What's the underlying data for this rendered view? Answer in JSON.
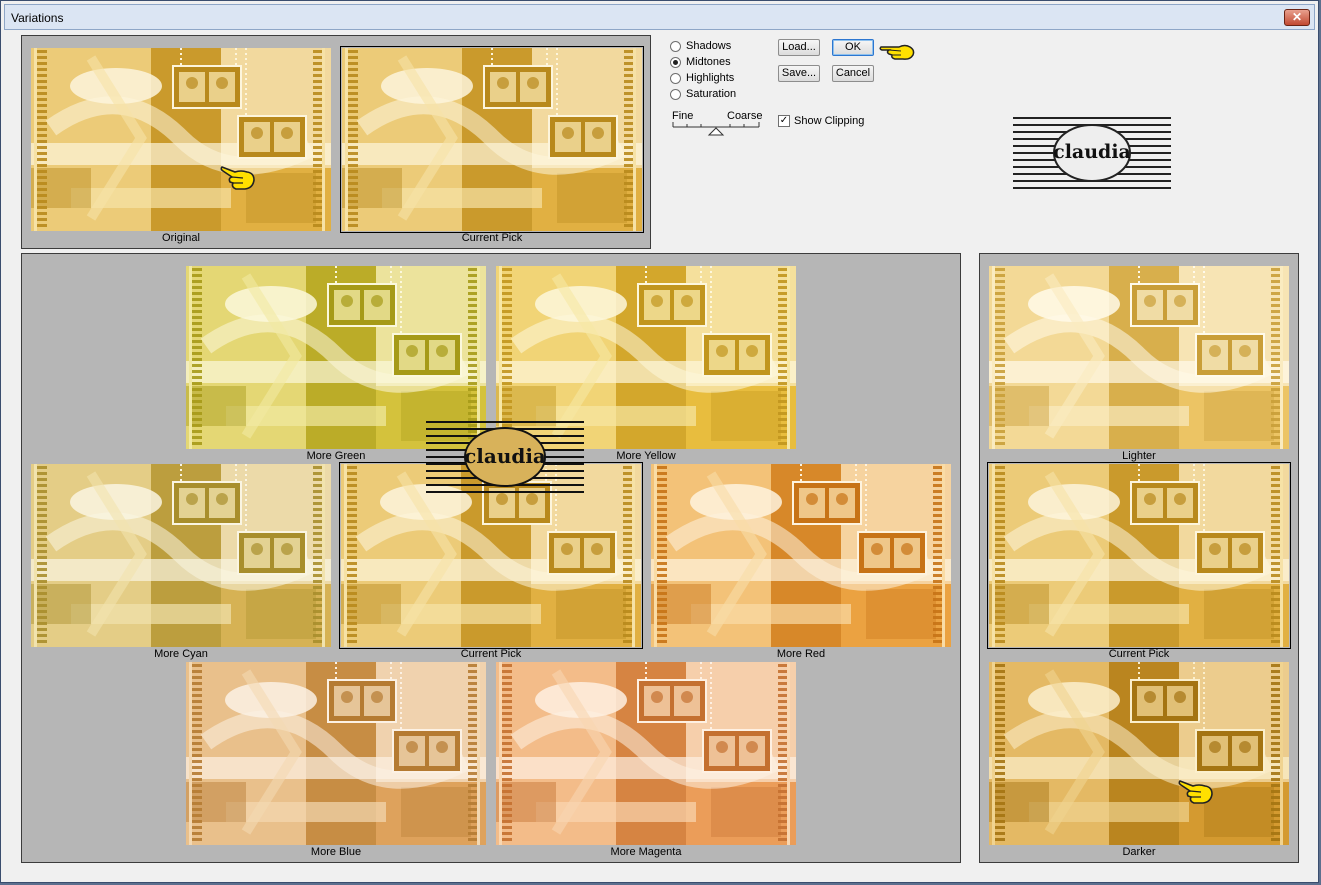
{
  "window": {
    "title": "Variations",
    "close_glyph": "✕"
  },
  "top_previews": [
    {
      "label": "Original",
      "tone": "orig"
    },
    {
      "label": "Current Pick",
      "tone": "orig"
    }
  ],
  "range_options": [
    {
      "label": "Shadows",
      "selected": false
    },
    {
      "label": "Midtones",
      "selected": true
    },
    {
      "label": "Highlights",
      "selected": false
    },
    {
      "label": "Saturation",
      "selected": false
    }
  ],
  "buttons": {
    "load": "Load...",
    "ok": "OK",
    "save": "Save...",
    "cancel": "Cancel"
  },
  "slider": {
    "fine_label": "Fine",
    "coarse_label": "Coarse",
    "level_fraction": 0.5
  },
  "show_clipping": {
    "label": "Show Clipping",
    "checked": true
  },
  "watermark": {
    "text": "claudia"
  },
  "color_variations": [
    {
      "label": "More Green",
      "tone": "green"
    },
    {
      "label": "More Yellow",
      "tone": "yellow"
    },
    {
      "label": "More Cyan",
      "tone": "cyan"
    },
    {
      "label": "Current Pick",
      "tone": "orig"
    },
    {
      "label": "More Red",
      "tone": "red"
    },
    {
      "label": "More Blue",
      "tone": "blue"
    },
    {
      "label": "More Magenta",
      "tone": "magenta"
    }
  ],
  "brightness_variations": [
    {
      "label": "Lighter",
      "tone": "lighter"
    },
    {
      "label": "Current Pick",
      "tone": "orig"
    },
    {
      "label": "Darker",
      "tone": "darker"
    }
  ],
  "tones": {
    "orig": {
      "dark": "#b8891c",
      "mid": "#e1b042",
      "light": "#f6e2a6",
      "pale": "#fdf5dc"
    },
    "green": {
      "dark": "#a69a18",
      "mid": "#d4c23c",
      "light": "#f1e9a2",
      "pale": "#fbf8dc"
    },
    "yellow": {
      "dark": "#c1961e",
      "mid": "#e8bd3e",
      "light": "#f7e7a4",
      "pale": "#fdf7dc"
    },
    "cyan": {
      "dark": "#a88e2c",
      "mid": "#d6b254",
      "light": "#f1e3ae",
      "pale": "#faf5e2"
    },
    "red": {
      "dark": "#c77316",
      "mid": "#eba241",
      "light": "#f9dca6",
      "pale": "#fef3de"
    },
    "blue": {
      "dark": "#b57b32",
      "mid": "#dea25c",
      "light": "#f3d8b2",
      "pale": "#fcf1e4"
    },
    "magenta": {
      "dark": "#c47030",
      "mid": "#eb9d59",
      "light": "#f9d6b0",
      "pale": "#fef0e2"
    },
    "lighter": {
      "dark": "#c99e38",
      "mid": "#ecc464",
      "light": "#faebc0",
      "pale": "#fffaea"
    },
    "darker": {
      "dark": "#a47412",
      "mid": "#d49a30",
      "light": "#f0d390",
      "pale": "#fbefcc"
    }
  }
}
